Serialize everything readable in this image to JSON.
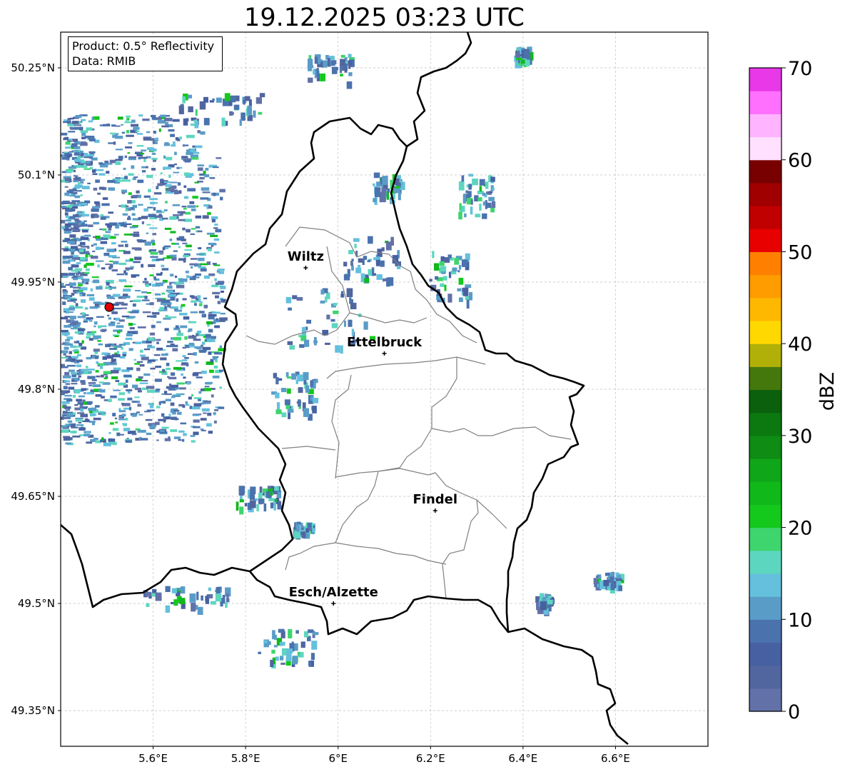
{
  "title": "19.12.2025 03:23 UTC",
  "info": {
    "product": "Product: 0.5° Reflectivity",
    "source": "Data: RMIB"
  },
  "axes": {
    "x_ticks": [
      "5.6°E",
      "5.8°E",
      "6°E",
      "6.2°E",
      "6.4°E",
      "6.6°E"
    ],
    "y_ticks": [
      "50.25°N",
      "50.1°N",
      "49.95°N",
      "49.8°N",
      "49.65°N",
      "49.5°N",
      "49.35°N"
    ],
    "lon_range": [
      5.4,
      6.8
    ],
    "lat_range": [
      49.3,
      50.3
    ]
  },
  "cities": [
    {
      "name": "Wiltz",
      "lon": 5.93,
      "lat": 49.97
    },
    {
      "name": "Ettelbruck",
      "lon": 6.1,
      "lat": 49.85
    },
    {
      "name": "Findel",
      "lon": 6.21,
      "lat": 49.63
    },
    {
      "name": "Esch/Alzette",
      "lon": 5.99,
      "lat": 49.5
    }
  ],
  "radar_site": {
    "lon": 5.505,
    "lat": 49.915,
    "color": "#e00000"
  },
  "colorbar": {
    "label": "dBZ",
    "ticks": [
      "0",
      "10",
      "20",
      "30",
      "40",
      "50",
      "60",
      "70"
    ],
    "min": 0,
    "max": 70,
    "step": 2.5,
    "colors": [
      "#6272a8",
      "#51659f",
      "#4660a2",
      "#4a72ad",
      "#5a9cc8",
      "#64c0dc",
      "#5dd6c0",
      "#3ed46e",
      "#14c81c",
      "#10b81a",
      "#10a61a",
      "#0e8c14",
      "#0c7810",
      "#0a600c",
      "#44780c",
      "#b0b008",
      "#ffd800",
      "#ffb800",
      "#ff9c00",
      "#ff8000",
      "#e80000",
      "#c00000",
      "#a00000",
      "#780000",
      "#ffe0ff",
      "#ffb4ff",
      "#ff70ff",
      "#e838e8"
    ]
  },
  "colors": {
    "border": "#000000",
    "cantons": "#808080",
    "grid": "#c0c0c0"
  }
}
